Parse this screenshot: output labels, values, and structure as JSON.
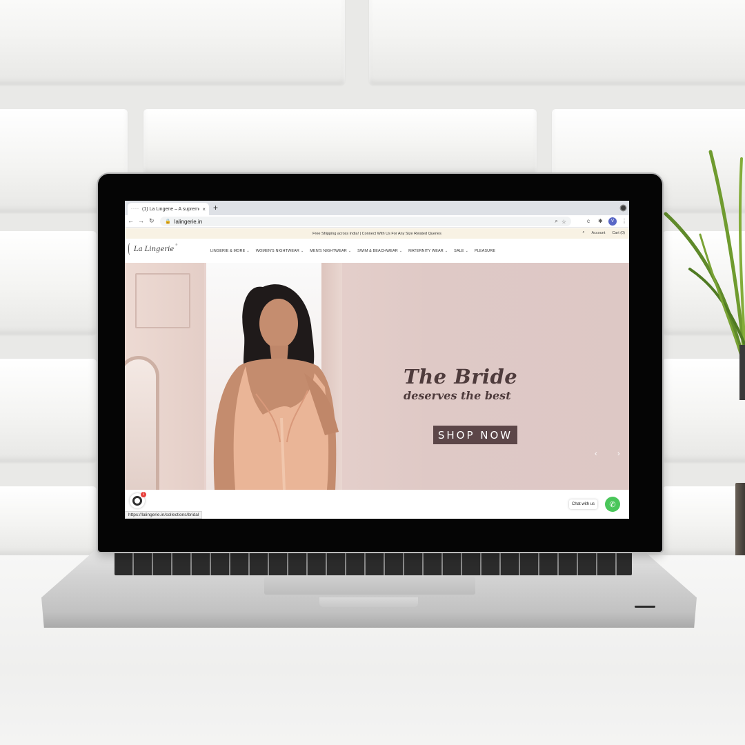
{
  "browser": {
    "tab_title": "(1) La Lingerie – A supreme of",
    "tab_dots": "····",
    "tab_close": "×",
    "new_tab": "+",
    "back": "←",
    "forward": "→",
    "reload": "↻",
    "lock": "🔒",
    "url": "lalingerie.in",
    "zoom_icon": "⌕",
    "star_icon": "☆",
    "ext1": "ᴄ",
    "ext2": "✱",
    "profile_initial": "V",
    "menu_icon": "⋮",
    "status_url": "https://lalingerie.in/collections/bridal"
  },
  "site": {
    "announcement": "Free Shipping across India! | Connect With Us For Any Size Related Queries",
    "search_icon": "⌕",
    "account_label": "Account",
    "cart_label": "Cart (0)",
    "logo_text": "La Lingerie",
    "logo_mark": "®",
    "nav": [
      {
        "label": "LINGERIE & MORE",
        "caret": "⌄"
      },
      {
        "label": "WOMEN'S NIGHTWEAR",
        "caret": "⌄"
      },
      {
        "label": "MEN'S NIGHTWEAR",
        "caret": "⌄"
      },
      {
        "label": "SWIM & BEACHWEAR",
        "caret": "⌄"
      },
      {
        "label": "MATERNITY WEAR",
        "caret": "⌄"
      },
      {
        "label": "SALE",
        "caret": "⌄"
      },
      {
        "label": "PLEASURE",
        "caret": ""
      }
    ]
  },
  "hero": {
    "headline": "The Bride",
    "subline": "deserves the best",
    "cta": "SHOP NOW",
    "prev": "‹",
    "next": "›"
  },
  "widgets": {
    "notification_count": "1",
    "chat_label": "Chat with us",
    "whatsapp_icon": "✆"
  },
  "colors": {
    "hero_bg": "#e3cfcb",
    "cta_bg": "#5c4648",
    "headline": "#4e3b3c",
    "announcement_bg": "#f8f2e4",
    "whatsapp": "#4ac65a",
    "profile": "#5967c6"
  }
}
